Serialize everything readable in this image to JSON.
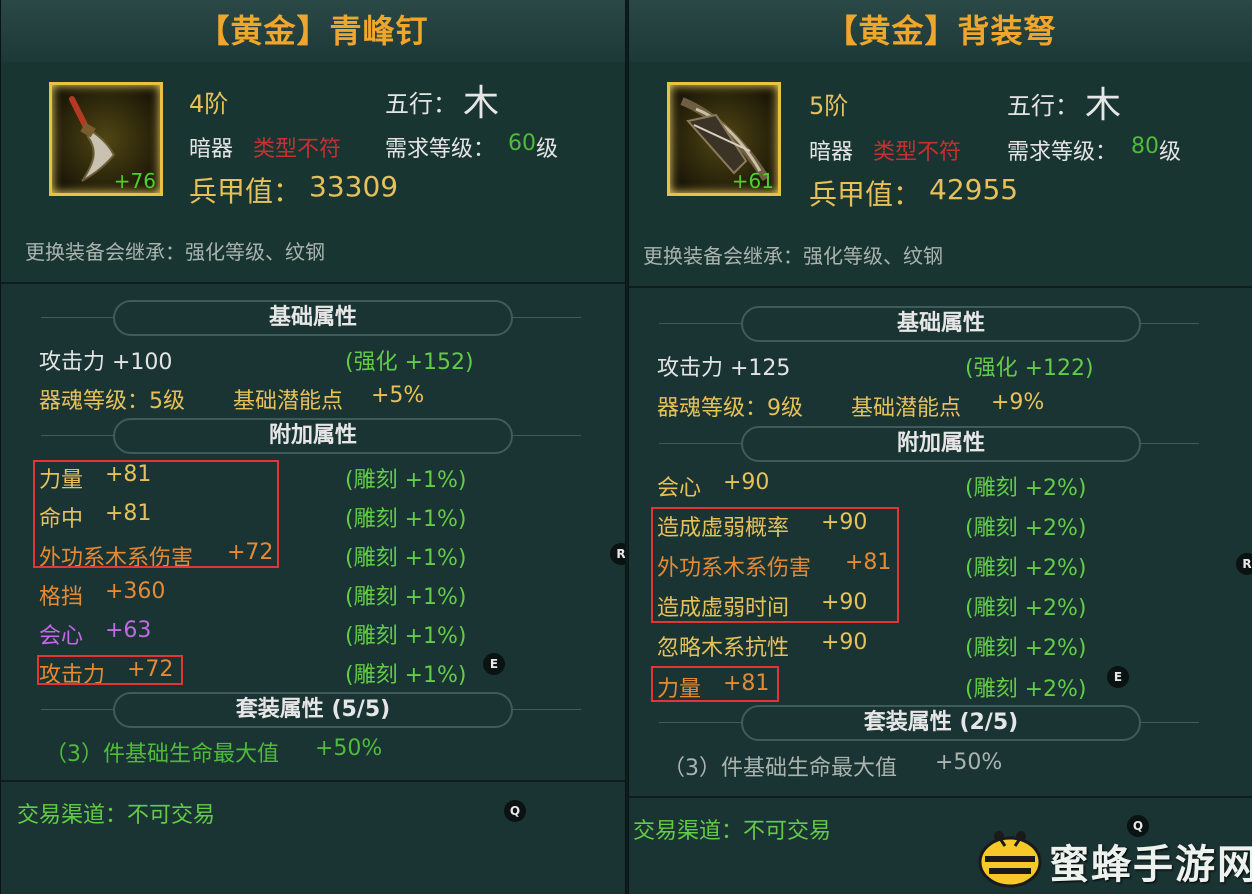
{
  "left": {
    "title": "【黄金】青峰钉",
    "item_plus": "+76",
    "tier": "4阶",
    "wuxing_label": "五行：",
    "wuxing_char": "木",
    "category": "暗器",
    "type_warning": "类型不符",
    "level_label": "需求等级：",
    "level_value": "60",
    "level_unit": "级",
    "armor_label": "兵甲值：",
    "armor_value": "33309",
    "inherit": "更换装备会继承：强化等级、纹钢",
    "base_head": "基础属性",
    "base_attack": "攻击力  +100",
    "base_strengthen": "(强化 +152)",
    "soul_level": "器魂等级：5级",
    "potential_label": "基础潜能点",
    "potential_value": "+5%",
    "extra_head": "附加属性",
    "extra": [
      {
        "name": "力量",
        "value": "+81",
        "carve": "(雕刻 +1%)"
      },
      {
        "name": "命中",
        "value": "+81",
        "carve": "(雕刻 +1%)"
      },
      {
        "name": "外功系木系伤害",
        "value": "+72",
        "carve": "(雕刻 +1%)"
      },
      {
        "name": "格挡",
        "value": "+360",
        "carve": "(雕刻 +1%)"
      },
      {
        "name": "会心",
        "value": "+63",
        "carve": "(雕刻 +1%)"
      },
      {
        "name": "攻击力",
        "value": "+72",
        "carve": "(雕刻 +1%)"
      }
    ],
    "set_head": "套装属性 (5/5)",
    "set_effect": "（3）件基础生命最大值",
    "set_effect_value": "+50%",
    "trade": "交易渠道：不可交易",
    "keys": [
      "R",
      "E",
      "Q"
    ]
  },
  "right": {
    "title": "【黄金】背装弩",
    "item_plus": "+61",
    "tier": "5阶",
    "wuxing_label": "五行：",
    "wuxing_char": "木",
    "category": "暗器",
    "type_warning": "类型不符",
    "level_label": "需求等级：",
    "level_value": "80",
    "level_unit": "级",
    "armor_label": "兵甲值：",
    "armor_value": "42955",
    "inherit": "更换装备会继承：强化等级、纹钢",
    "base_head": "基础属性",
    "base_attack": "攻击力  +125",
    "base_strengthen": "(强化 +122)",
    "soul_level": "器魂等级：9级",
    "potential_label": "基础潜能点",
    "potential_value": "+9%",
    "extra_head": "附加属性",
    "extra": [
      {
        "name": "会心",
        "value": "+90",
        "carve": "(雕刻 +2%)"
      },
      {
        "name": "造成虚弱概率",
        "value": "+90",
        "carve": "(雕刻 +2%)"
      },
      {
        "name": "外功系木系伤害",
        "value": "+81",
        "carve": "(雕刻 +2%)"
      },
      {
        "name": "造成虚弱时间",
        "value": "+90",
        "carve": "(雕刻 +2%)"
      },
      {
        "name": "忽略木系抗性",
        "value": "+90",
        "carve": "(雕刻 +2%)"
      },
      {
        "name": "力量",
        "value": "+81",
        "carve": "(雕刻 +2%)"
      }
    ],
    "set_head": "套装属性 (2/5)",
    "set_effect": "（3）件基础生命最大值",
    "set_effect_value": "+50%",
    "trade": "交易渠道：不可交易",
    "keys": [
      "R",
      "E",
      "Q"
    ]
  },
  "watermark": "蜜蜂手游网",
  "colors": {
    "title": "#f0a62a",
    "highlight_box": "#e23535",
    "level_value": "#4ebb3a"
  }
}
